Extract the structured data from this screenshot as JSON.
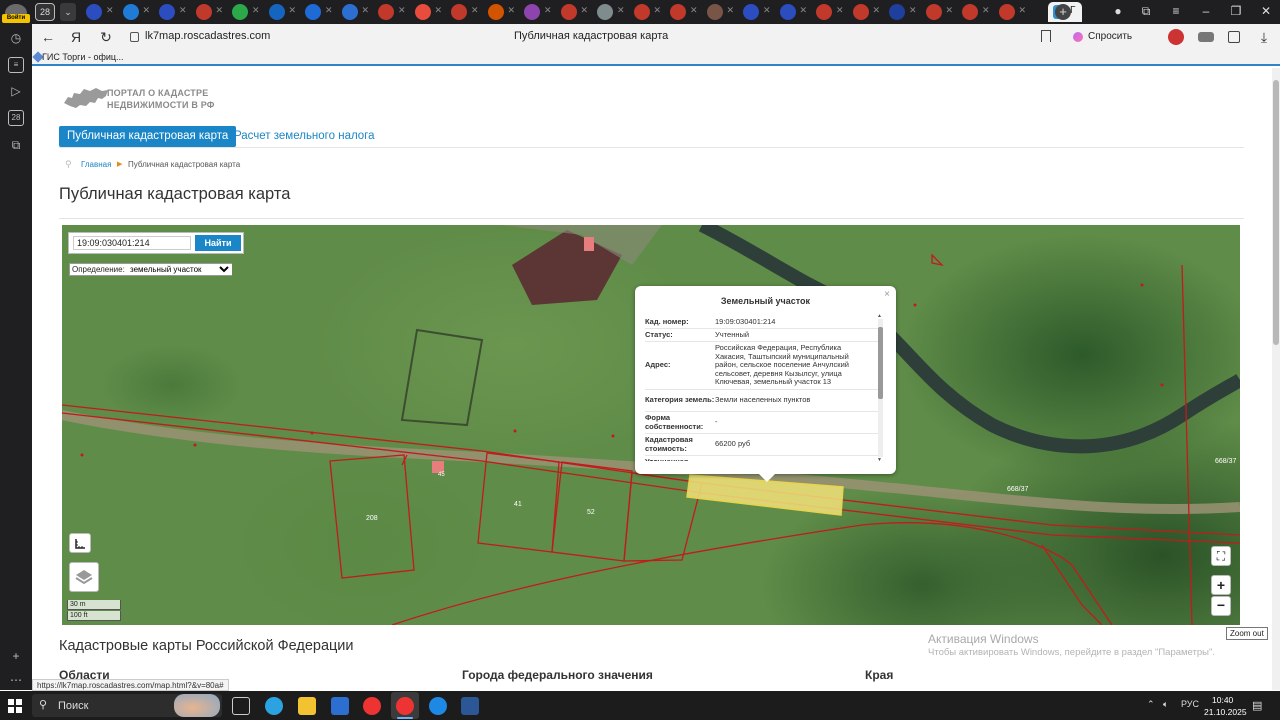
{
  "browser": {
    "side_panel": {
      "login_label": "Войти",
      "tab_count": "28",
      "calendar_day": "28"
    },
    "tab_count": "28",
    "active_tab_label": "Г",
    "url": "lk7map.roscadastres.com",
    "page_title": "Публичная кадастровая карта",
    "ask_button": "Спросить",
    "bookmark": "ГИС Торги - офиц...",
    "status_url": "https://lk7map.roscadastres.com/map.html?&v=80a#"
  },
  "portal": {
    "logo_line1": "ПОРТАЛ О КАДАСТРЕ",
    "logo_line2": "НЕДВИЖИМОСТИ В РФ",
    "nav_active": "Публичная кадастровая карта",
    "nav_tax": "Расчет земельного налога",
    "breadcrumb_home": "Главная",
    "breadcrumb_current": "Публичная кадастровая карта",
    "heading": "Публичная кадастровая карта",
    "section_heading": "Кадастровые карты Российской Федерации",
    "columns": [
      "Области",
      "Города федерального значения",
      "Края"
    ]
  },
  "map": {
    "search_value": "19:09:030401:214",
    "search_button": "Найти",
    "definition_label": "Определение:",
    "definition_value": "земельный участок",
    "definition_options": [
      "земельный участок"
    ],
    "scale_m": "30 m",
    "scale_ft": "100 ft",
    "parcel_labels": [
      {
        "id": "p1",
        "text": "208"
      },
      {
        "id": "p2",
        "text": "41"
      },
      {
        "id": "p3",
        "text": "52"
      },
      {
        "id": "p4",
        "text": "668/37"
      },
      {
        "id": "p5",
        "text": "668/37"
      },
      {
        "id": "p6",
        "text": "45"
      }
    ],
    "zoom_tooltip": "Zoom out"
  },
  "popup": {
    "title": "Земельный участок",
    "rows": [
      {
        "key": "Кад. номер:",
        "value": "19:09:030401:214"
      },
      {
        "key": "Статус:",
        "value": "Учтенный"
      },
      {
        "key": "Адрес:",
        "value": "Российская Федерация, Республика Хакасия, Таштыпский муниципальный район, сельское поселение Анчулский сельсовет, деревня Кызылсуг, улица Ключевая, земельный участок 13"
      },
      {
        "key": "Категория земель:",
        "value": "Земли населенных пунктов"
      },
      {
        "key": "Форма собственности:",
        "value": "-"
      },
      {
        "key": "Кадастровая стоимость:",
        "value": "66200 руб"
      },
      {
        "key": "Уточненная",
        "value": ""
      }
    ]
  },
  "windows": {
    "activation_title": "Активация Windows",
    "activation_text": "Чтобы активировать Windows, перейдите в раздел \"Параметры\".",
    "search_label": "Поиск",
    "lang": "РУС",
    "time": "10:40",
    "date": "21.10.2025"
  }
}
